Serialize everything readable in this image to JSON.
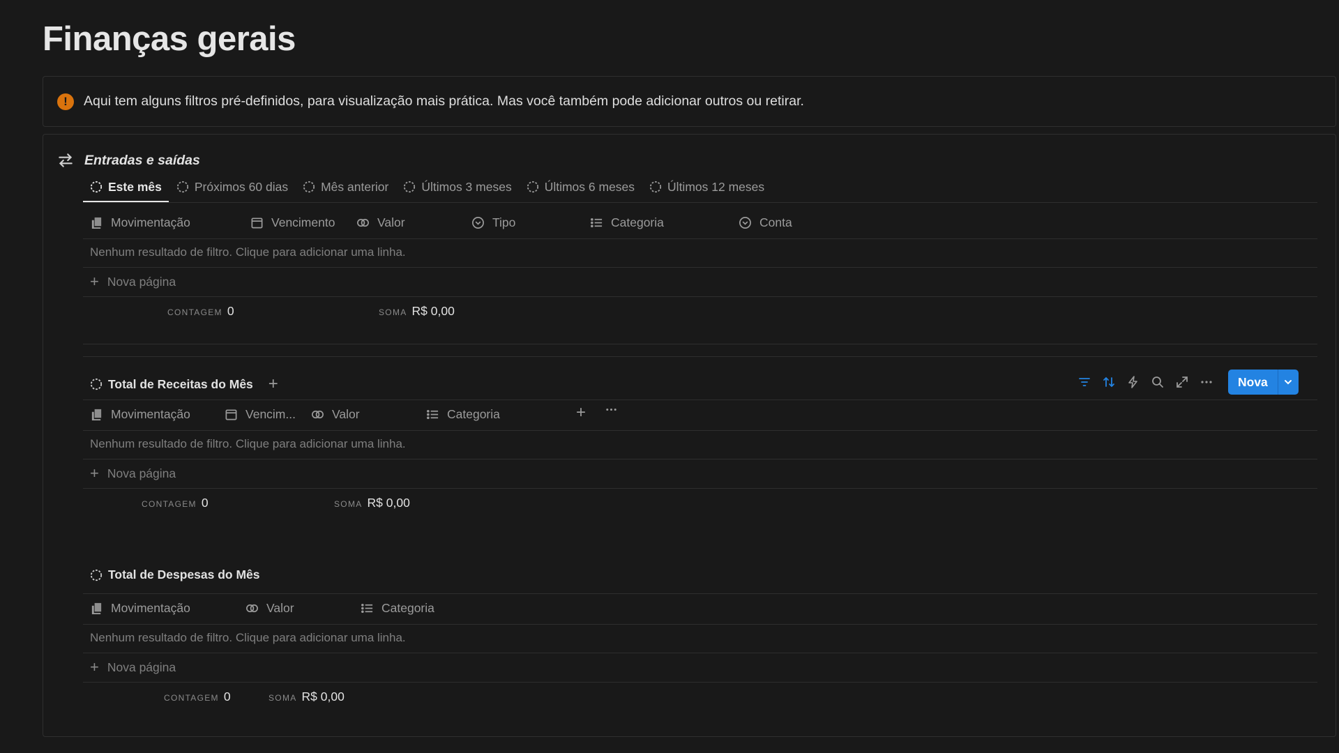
{
  "page": {
    "title": "Finanças gerais"
  },
  "callout": {
    "icon": "exclamation-icon",
    "text": "Aqui tem alguns filtros pré-definidos, para visualização mais prática. Mas você também pode adicionar outros ou retirar.",
    "accent_color": "#d9730d"
  },
  "section": {
    "title": "Entradas e saídas",
    "icon": "arrows-swap-icon",
    "tabs": [
      {
        "label": "Este mês",
        "active": true
      },
      {
        "label": "Próximos 60 dias"
      },
      {
        "label": "Mês anterior"
      },
      {
        "label": "Últimos 3 meses"
      },
      {
        "label": "Últimos 6 meses"
      },
      {
        "label": "Últimos 12 meses"
      }
    ],
    "columns": [
      "Movimentação",
      "Vencimento",
      "Valor",
      "Tipo",
      "Categoria",
      "Conta"
    ],
    "empty_text": "Nenhum resultado de filtro. Clique para adicionar uma linha.",
    "new_page": "Nova página",
    "count_label": "CONTAGEM",
    "count_value": "0",
    "sum_label": "SOMA",
    "sum_value": "R$ 0,00"
  },
  "receitas": {
    "title": "Total de Receitas do Mês",
    "columns": [
      "Movimentação",
      "Vencim...",
      "Valor",
      "Categoria"
    ],
    "empty_text": "Nenhum resultado de filtro. Clique para adicionar uma linha.",
    "new_page": "Nova página",
    "count_label": "CONTAGEM",
    "count_value": "0",
    "sum_label": "SOMA",
    "sum_value": "R$ 0,00",
    "toolbar": {
      "new_label": "Nova",
      "accent_color": "#2383e2"
    }
  },
  "despesas": {
    "title": "Total de Despesas do Mês",
    "columns": [
      "Movimentação",
      "Valor",
      "Categoria"
    ],
    "empty_text": "Nenhum resultado de filtro. Clique para adicionar uma linha.",
    "new_page": "Nova página",
    "count_label": "CONTAGEM",
    "count_value": "0",
    "sum_label": "SOMA",
    "sum_value": "R$ 0,00"
  }
}
